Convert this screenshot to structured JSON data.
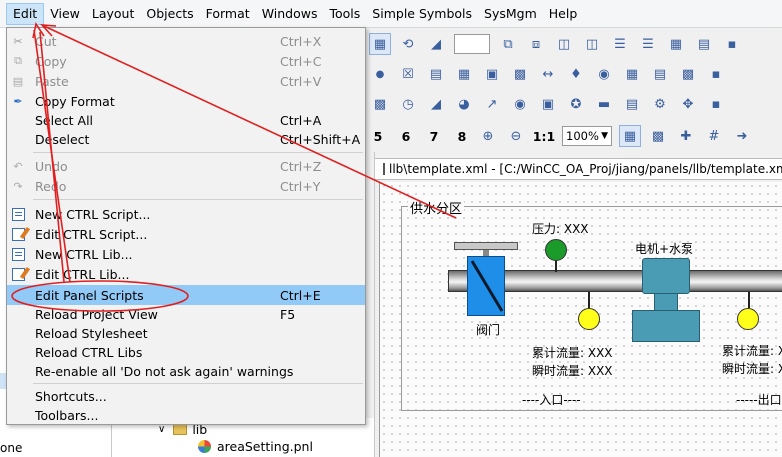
{
  "menubar": {
    "items": [
      "Edit",
      "View",
      "Layout",
      "Objects",
      "Format",
      "Windows",
      "Tools",
      "Simple Symbols",
      "SysMgm",
      "Help"
    ]
  },
  "edit_menu": {
    "items": [
      {
        "label": "Cut",
        "shortcut": "Ctrl+X",
        "enabled": false,
        "icon": "cut-icon"
      },
      {
        "label": "Copy",
        "shortcut": "Ctrl+C",
        "enabled": false,
        "icon": "copy-icon"
      },
      {
        "label": "Paste",
        "shortcut": "Ctrl+V",
        "enabled": false,
        "icon": "paste-icon"
      },
      {
        "label": "Copy Format",
        "shortcut": "",
        "enabled": true,
        "icon": "brush-icon"
      },
      {
        "label": "Select All",
        "shortcut": "Ctrl+A",
        "enabled": true
      },
      {
        "label": "Deselect",
        "shortcut": "Ctrl+Shift+A",
        "enabled": true
      },
      {
        "label": "Undo",
        "shortcut": "Ctrl+Z",
        "enabled": false,
        "icon": "undo-icon"
      },
      {
        "label": "Redo",
        "shortcut": "Ctrl+Y",
        "enabled": false,
        "icon": "redo-icon"
      },
      {
        "label": "New CTRL Script...",
        "shortcut": "",
        "enabled": true,
        "icon": "new-script-icon"
      },
      {
        "label": "Edit CTRL Script...",
        "shortcut": "",
        "enabled": true,
        "icon": "edit-script-icon"
      },
      {
        "label": "New CTRL Lib...",
        "shortcut": "",
        "enabled": true,
        "icon": "new-lib-icon"
      },
      {
        "label": "Edit CTRL Lib...",
        "shortcut": "",
        "enabled": true,
        "icon": "edit-lib-icon"
      },
      {
        "label": "Edit Panel Scripts",
        "shortcut": "Ctrl+E",
        "enabled": true,
        "highlighted": true
      },
      {
        "label": "Reload Project View",
        "shortcut": "F5",
        "enabled": true
      },
      {
        "label": "Reload Stylesheet",
        "shortcut": "",
        "enabled": true
      },
      {
        "label": "Reload CTRL Libs",
        "shortcut": "",
        "enabled": true
      },
      {
        "label": "Re-enable all 'Do not ask again' warnings",
        "shortcut": "",
        "enabled": true
      },
      {
        "label": "Shortcuts...",
        "shortcut": "",
        "enabled": true
      },
      {
        "label": "Toolbars...",
        "shortcut": "",
        "enabled": true
      }
    ]
  },
  "toolbar": {
    "number_buttons": [
      "5",
      "6",
      "7",
      "8"
    ],
    "ratio_label": "1:1",
    "zoom_value": "100%"
  },
  "left_dock": {
    "bottom_label": "one"
  },
  "project_tree": {
    "folder_label": "lib",
    "file_label": "areaSetting.pnl"
  },
  "panel_window": {
    "title": "llb\\template.xml - [C:/WinCC_OA_Proj/jiang/panels/llb/template.xml]"
  },
  "canvas": {
    "frame_label": "供水分区",
    "pressure_label": "压力: XXX",
    "pump_label": "电机+水泵",
    "valve_label": "阀门",
    "cumulative_flow_1": "累计流量: XXX",
    "instant_flow_1": "瞬时流量: XXX",
    "inlet_label": "----入口----",
    "cumulative_flow_2": "累计流量: X",
    "instant_flow_2": "瞬时流量: X",
    "outlet_label": "-----出口"
  },
  "colors": {
    "menu_highlight": "#91c9f7",
    "annotation_red": "#e02020",
    "valve_blue": "#1f8ee8",
    "pump_teal": "#4a9cb5",
    "sensor_green": "#1b9b2a",
    "sensor_yellow": "#ffff1a"
  }
}
